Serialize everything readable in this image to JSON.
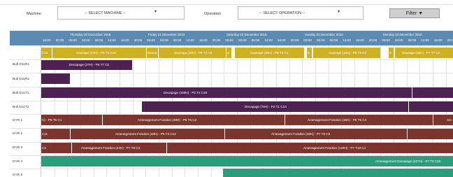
{
  "filters": {
    "machine_label": "Machine",
    "machine_select": "-- SELECT MACHINE --",
    "operation_label": "Operation",
    "operation_select": "-- SELECT OPERATION --",
    "filter_button": "Filter"
  },
  "timeline": {
    "days": [
      "Thursday 20 December 2018",
      "Friday 21 December 2018",
      "Saturday 22 December 2018",
      "Sunday 23 December 2018",
      "Monday 24 December 2018"
    ],
    "first_tick": "16:00",
    "hours": [
      "00:00",
      "04:00",
      "08:00",
      "12:00",
      "16:00",
      "20:00"
    ]
  },
  "rows": [
    {
      "label": "",
      "bars": [
        {
          "label": "C10"
        },
        {
          "label": "Sausage (24H) - P5 T1 C16"
        },
        {
          "label": "Sausa"
        },
        {
          "label": "Sausage (20H) - P5 T7 C6"
        },
        {
          "label": "S"
        },
        {
          "label": "Sausage (20H) - P5 T4 C1"
        },
        {
          "label": "S"
        },
        {
          "label": "Sausage (15H) - P5 T5 C2"
        },
        {
          "label": "S"
        },
        {
          "label": "Sausage (15H) - P7 T7 C3"
        }
      ]
    },
    {
      "label": "Bull D11R1",
      "bars": [
        {
          "label": "Decapage (27H) - P5 T7 C0"
        }
      ]
    },
    {
      "label": "Bull D11R2",
      "bars": [
        {
          "label": ""
        }
      ]
    },
    {
      "label": "Bull D11T1",
      "bars": [
        {
          "label": "Decapage (159H) - P2 T2 C40"
        },
        {
          "label": ""
        }
      ]
    },
    {
      "label": "Bull D11T2",
      "bars": [
        {
          "label": "Decapage (76H) - P2 T1 C10"
        },
        {
          "label": ""
        }
      ]
    },
    {
      "label": "DYR 1",
      "bars": [
        {
          "label": "H) - P5 T5 C1"
        },
        {
          "label": "Amenagement Foration (48H) - P5 T5 C2"
        },
        {
          "label": "Amenagement Foration (48H) - P5 T5 C3"
        },
        {
          "label": "Am"
        }
      ]
    },
    {
      "label": "DYR 2",
      "bars": [
        {
          "label": "C11"
        },
        {
          "label": "Amenagement Foration (48H) - P5 T3 C12"
        },
        {
          "label": "Amenagement Foration (48H) - P7 T8 C6"
        },
        {
          "label": ""
        }
      ]
    },
    {
      "label": "DYR 3",
      "bars": [
        {
          "label": "C2"
        },
        {
          "label": "Amenagement Foration (24H) - P7 T8 C3"
        },
        {
          "label": "Amenagement Foration (120H) - P7 T10 C1"
        }
      ]
    },
    {
      "label": "DYR 4",
      "bars": [
        {
          "label": "Amenagement Decapage (427H) - P7 T8 C25"
        }
      ]
    },
    {
      "label": "DYR 5",
      "bars": [
        {
          "label": ""
        }
      ]
    }
  ]
}
